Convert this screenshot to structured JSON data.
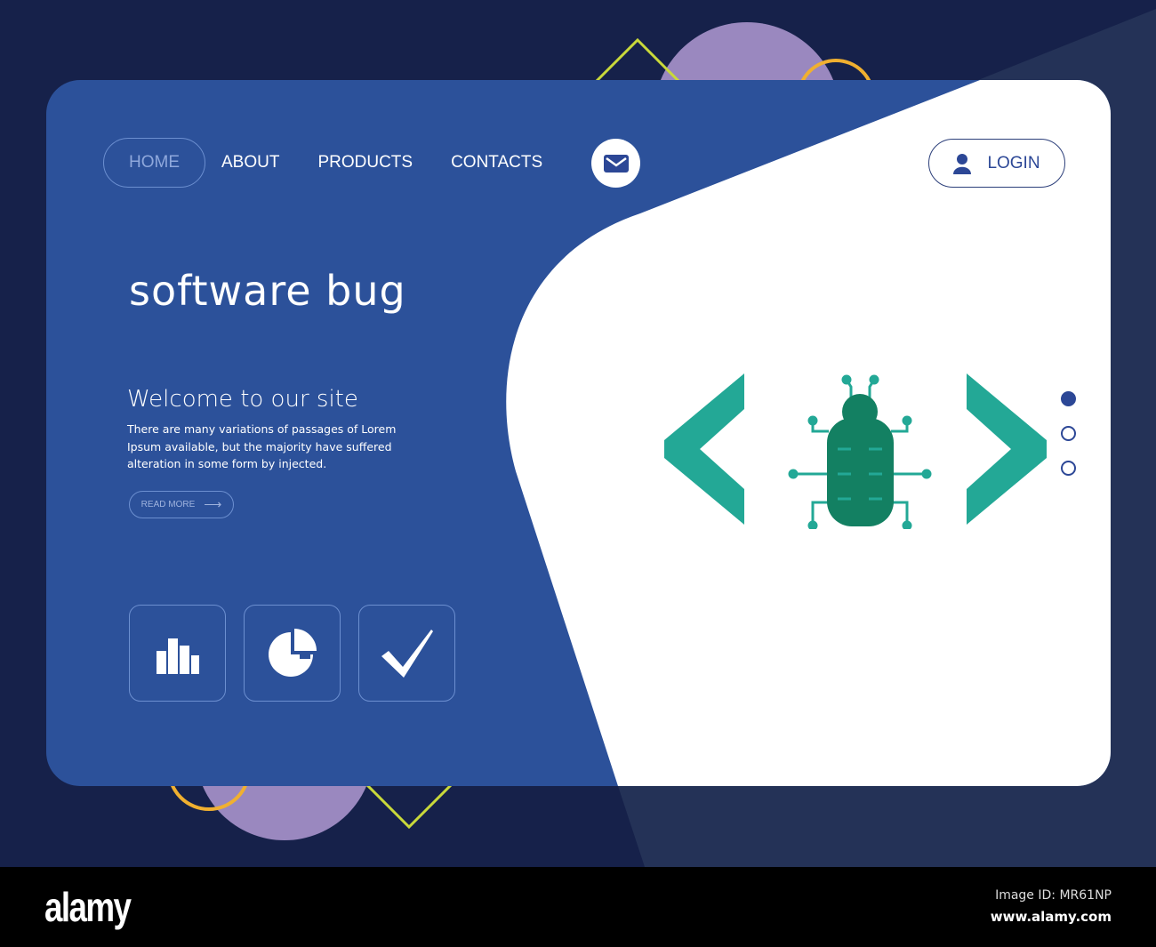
{
  "nav": {
    "items": [
      "HOME",
      "ABOUT",
      "PRODUCTS",
      "CONTACTS"
    ],
    "login": "LOGIN"
  },
  "hero": {
    "title": "software bug",
    "welcome": "Welcome to our site",
    "description": "There are many variations of passages of Lorem Ipsum available, but the majority have suffered alteration in some form by injected.",
    "read_more": "READ MORE"
  },
  "slider": {
    "active": 1,
    "count": 3
  },
  "footer": {
    "logo": "alamy",
    "image_id": "Image ID: MR61NP",
    "site": "www.alamy.com"
  },
  "colors": {
    "background": "#16214a",
    "panel": "#2c519a",
    "teal": "#23a896",
    "bug": "#138062"
  }
}
